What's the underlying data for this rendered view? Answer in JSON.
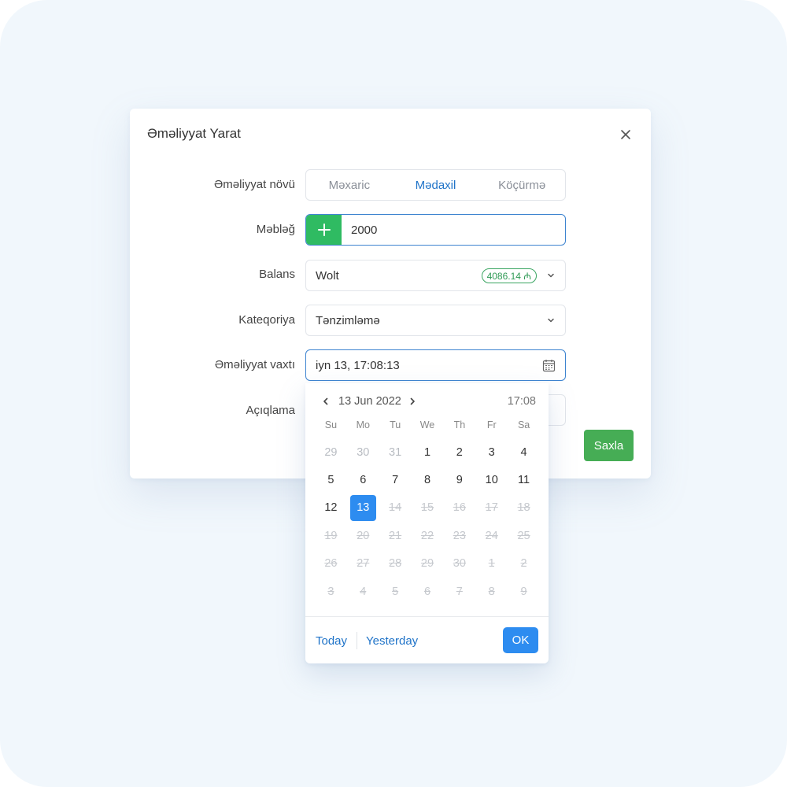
{
  "modal": {
    "title": "Əməliyyat Yarat",
    "close_icon": "close-icon"
  },
  "form": {
    "type_label": "Əməliyyat növü",
    "type_options": [
      "Məxaric",
      "Mədaxil",
      "Köçürmə"
    ],
    "type_selected": "Mədaxil",
    "amount_label": "Məbləğ",
    "amount_sign_icon": "plus-icon",
    "amount_value": "2000",
    "balance_label": "Balans",
    "balance_value": "Wolt",
    "balance_badge": "4086.14 ₼",
    "category_label": "Kateqoriya",
    "category_value": "Tənzimləmə",
    "time_label": "Əməliyyat vaxtı",
    "time_value": "iyn 13, 17:08:13",
    "description_label": "Açıqlama",
    "save_label": "Saxla"
  },
  "datepicker": {
    "title": "13 Jun 2022",
    "time": "17:08",
    "weekdays": [
      "Su",
      "Mo",
      "Tu",
      "We",
      "Th",
      "Fr",
      "Sa"
    ],
    "days": [
      {
        "d": "29",
        "s": "other"
      },
      {
        "d": "30",
        "s": "other"
      },
      {
        "d": "31",
        "s": "other"
      },
      {
        "d": "1",
        "s": "normal"
      },
      {
        "d": "2",
        "s": "normal"
      },
      {
        "d": "3",
        "s": "normal"
      },
      {
        "d": "4",
        "s": "normal"
      },
      {
        "d": "5",
        "s": "normal"
      },
      {
        "d": "6",
        "s": "normal"
      },
      {
        "d": "7",
        "s": "normal"
      },
      {
        "d": "8",
        "s": "normal"
      },
      {
        "d": "9",
        "s": "normal"
      },
      {
        "d": "10",
        "s": "normal"
      },
      {
        "d": "11",
        "s": "normal"
      },
      {
        "d": "12",
        "s": "normal"
      },
      {
        "d": "13",
        "s": "selected"
      },
      {
        "d": "14",
        "s": "disabled"
      },
      {
        "d": "15",
        "s": "disabled"
      },
      {
        "d": "16",
        "s": "disabled"
      },
      {
        "d": "17",
        "s": "disabled"
      },
      {
        "d": "18",
        "s": "disabled"
      },
      {
        "d": "19",
        "s": "disabled"
      },
      {
        "d": "20",
        "s": "disabled"
      },
      {
        "d": "21",
        "s": "disabled"
      },
      {
        "d": "22",
        "s": "disabled"
      },
      {
        "d": "23",
        "s": "disabled"
      },
      {
        "d": "24",
        "s": "disabled"
      },
      {
        "d": "25",
        "s": "disabled"
      },
      {
        "d": "26",
        "s": "disabled"
      },
      {
        "d": "27",
        "s": "disabled"
      },
      {
        "d": "28",
        "s": "disabled"
      },
      {
        "d": "29",
        "s": "disabled"
      },
      {
        "d": "30",
        "s": "disabled"
      },
      {
        "d": "1",
        "s": "disabled"
      },
      {
        "d": "2",
        "s": "disabled"
      },
      {
        "d": "3",
        "s": "disabled"
      },
      {
        "d": "4",
        "s": "disabled"
      },
      {
        "d": "5",
        "s": "disabled"
      },
      {
        "d": "6",
        "s": "disabled"
      },
      {
        "d": "7",
        "s": "disabled"
      },
      {
        "d": "8",
        "s": "disabled"
      },
      {
        "d": "9",
        "s": "disabled"
      }
    ],
    "today_label": "Today",
    "yesterday_label": "Yesterday",
    "ok_label": "OK",
    "prev_icon": "chevron-left-icon",
    "next_icon": "chevron-right-icon"
  },
  "colors": {
    "accent_blue": "#2d8cf0",
    "save_green": "#46ad55",
    "plus_green": "#2fbb62",
    "link_blue": "#1f73c8"
  }
}
